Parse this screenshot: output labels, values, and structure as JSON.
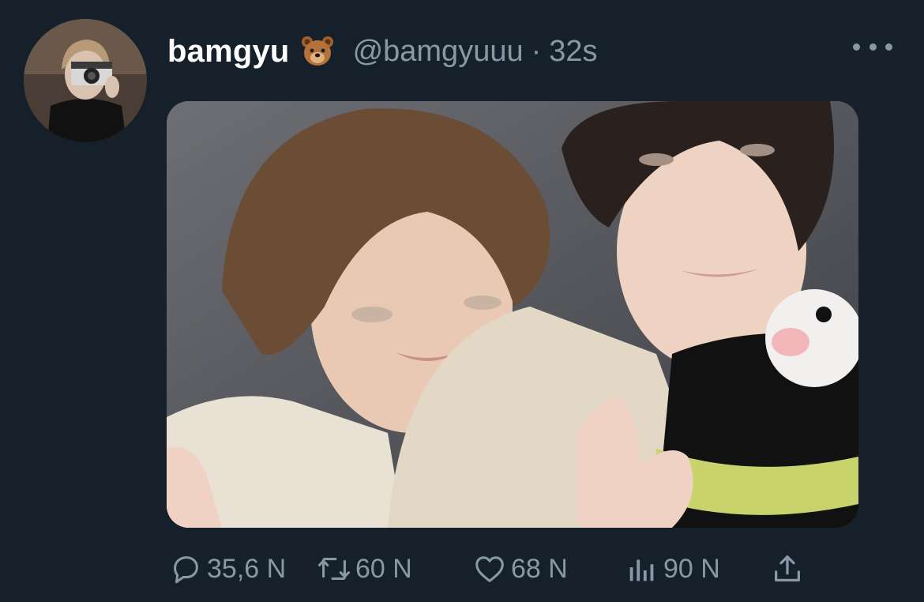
{
  "tweet": {
    "author": {
      "display_name": "bamgyu",
      "name_emoji": "bear-face-emoji",
      "handle": "@bamgyuuu",
      "separator": "·",
      "time": "32s"
    },
    "media": {
      "type": "photo"
    },
    "actions": {
      "reply_count": "35,6 N",
      "retweet_count": "60 N",
      "like_count": "68 N",
      "view_count": "90 N"
    }
  },
  "colors": {
    "background": "#15202b",
    "primary_text": "#ffffff",
    "secondary_text": "#8899a6"
  },
  "icons": {
    "more": "more-horizontal-icon",
    "reply": "reply-icon",
    "retweet": "retweet-icon",
    "like": "heart-icon",
    "views": "analytics-icon",
    "share": "share-icon"
  }
}
